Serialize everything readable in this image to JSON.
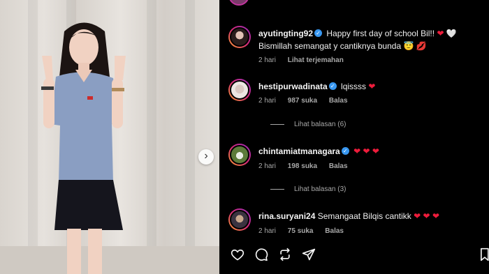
{
  "comments": [
    {
      "user": "ayutingting92",
      "verified": true,
      "text": "Happy first day of school Bil!! ❤️ 🤍 Bismillah semangat y cantiknya bunda 😇 💋",
      "time": "2 hari",
      "likes": "",
      "action": "Lihat terjemahan",
      "view_replies": ""
    },
    {
      "user": "hestipurwadinata",
      "verified": true,
      "text": "lqissss ❤️",
      "time": "2 hari",
      "likes": "987 suka",
      "action": "Balas",
      "view_replies": "Lihat balasan (6)"
    },
    {
      "user": "chintamiatmanagara",
      "verified": true,
      "text": "❤️ ❤️ ❤️",
      "time": "2 hari",
      "likes": "198 suka",
      "action": "Balas",
      "view_replies": "Lihat balasan (3)"
    },
    {
      "user": "rina.suryani24",
      "verified": false,
      "text": "Semangaat Bilqis cantikk ❤️ ❤️ ❤️",
      "time": "2 hari",
      "likes": "75 suka",
      "action": "Balas",
      "view_replies": ""
    }
  ],
  "icons": {
    "like": "heart-icon",
    "comment": "comment-icon",
    "repost": "repost-icon",
    "share": "send-icon",
    "next": "chevron-right-icon"
  },
  "colors": {
    "background": "#000000",
    "heart": "#ed1c3b",
    "verified": "#3897f0",
    "muted": "#a8a8a8"
  }
}
